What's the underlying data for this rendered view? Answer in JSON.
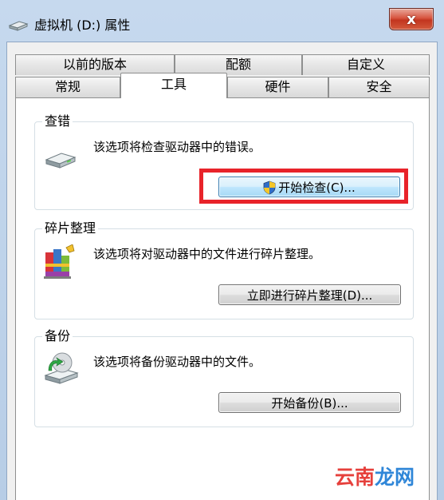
{
  "window": {
    "title": "虚拟机 (D:) 属性",
    "close_symbol": "x"
  },
  "tabs": {
    "row_back": [
      {
        "label": "以前的版本"
      },
      {
        "label": "配额"
      },
      {
        "label": "自定义"
      }
    ],
    "row_front": [
      {
        "label": "常规"
      },
      {
        "label": "工具",
        "active": true
      },
      {
        "label": "硬件"
      },
      {
        "label": "安全"
      }
    ]
  },
  "groups": {
    "error_check": {
      "title": "查错",
      "description": "该选项将检查驱动器中的错误。",
      "button_label": "开始检查(C)..."
    },
    "defrag": {
      "title": "碎片整理",
      "description": "该选项将对驱动器中的文件进行碎片整理。",
      "button_label": "立即进行碎片整理(D)..."
    },
    "backup": {
      "title": "备份",
      "description": "该选项将备份驱动器中的文件。",
      "button_label": "开始备份(B)..."
    }
  },
  "watermark": {
    "part1": "云南",
    "part2": "龙网"
  },
  "colors": {
    "highlight": "#e8232a",
    "close_button": "#c2351f",
    "watermark_red": "#e6403c",
    "watermark_blue": "#2f86d8"
  },
  "icons": {
    "title": "drive-icon",
    "error_check": "drive-icon",
    "defrag": "defrag-icon",
    "backup": "backup-icon",
    "button_shield": "shield-icon"
  }
}
